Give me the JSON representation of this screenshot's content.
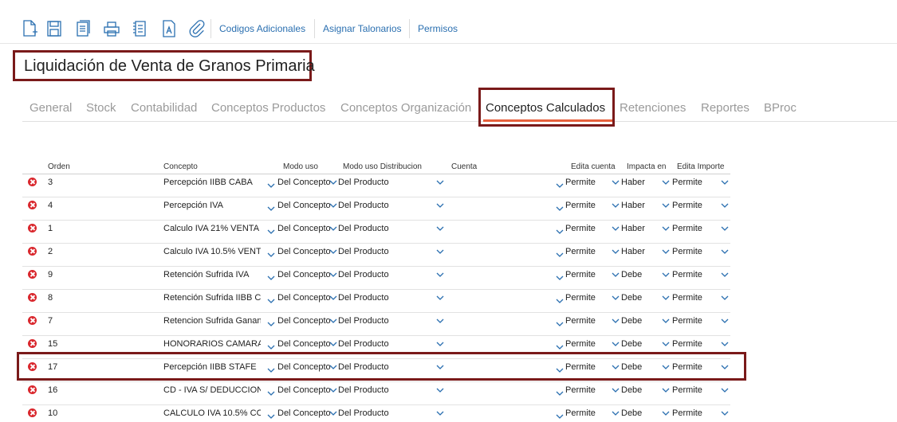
{
  "toolbar": {
    "icons": [
      "new-document-icon",
      "save-icon",
      "copy-document-icon",
      "print-icon",
      "document-list-icon",
      "text-document-icon",
      "attachment-icon"
    ],
    "links": [
      "Codigos Adicionales",
      "Asignar Talonarios",
      "Permisos"
    ]
  },
  "page": {
    "title": "Liquidación de Venta de Granos Primaria"
  },
  "tabs": [
    "General",
    "Stock",
    "Contabilidad",
    "Conceptos Productos",
    "Conceptos Organización",
    "Conceptos Calculados",
    "Retenciones",
    "Reportes",
    "BProc"
  ],
  "active_tab": "Conceptos Calculados",
  "grid": {
    "headers": [
      "Orden",
      "Concepto",
      "Modo uso",
      "Modo uso Distribucion",
      "Cuenta",
      "Edita cuenta",
      "Impacta en",
      "Edita Importe"
    ],
    "rows": [
      {
        "orden": "3",
        "concepto": "Percepción IIBB CABA",
        "modo_uso": "Del Concepto",
        "modo_dist": "Del Producto",
        "cuenta": "",
        "edita_cuenta": "Permite",
        "impacta": "Haber",
        "edita_importe": "Permite"
      },
      {
        "orden": "4",
        "concepto": "Percepción IVA",
        "modo_uso": "Del Concepto",
        "modo_dist": "Del Producto",
        "cuenta": "",
        "edita_cuenta": "Permite",
        "impacta": "Haber",
        "edita_importe": "Permite"
      },
      {
        "orden": "1",
        "concepto": "Calculo IVA 21% VENTA",
        "modo_uso": "Del Concepto",
        "modo_dist": "Del Producto",
        "cuenta": "",
        "edita_cuenta": "Permite",
        "impacta": "Haber",
        "edita_importe": "Permite"
      },
      {
        "orden": "2",
        "concepto": "Calculo IVA 10.5% VENT",
        "modo_uso": "Del Concepto",
        "modo_dist": "Del Producto",
        "cuenta": "",
        "edita_cuenta": "Permite",
        "impacta": "Haber",
        "edita_importe": "Permite"
      },
      {
        "orden": "9",
        "concepto": "Retención Sufrida IVA",
        "modo_uso": "Del Concepto",
        "modo_dist": "Del Producto",
        "cuenta": "",
        "edita_cuenta": "Permite",
        "impacta": "Debe",
        "edita_importe": "Permite"
      },
      {
        "orden": "8",
        "concepto": "Retención Sufrida IIBB C",
        "modo_uso": "Del Concepto",
        "modo_dist": "Del Producto",
        "cuenta": "",
        "edita_cuenta": "Permite",
        "impacta": "Debe",
        "edita_importe": "Permite"
      },
      {
        "orden": "7",
        "concepto": "Retencion Sufrida Ganan",
        "modo_uso": "Del Concepto",
        "modo_dist": "Del Producto",
        "cuenta": "",
        "edita_cuenta": "Permite",
        "impacta": "Debe",
        "edita_importe": "Permite"
      },
      {
        "orden": "15",
        "concepto": "HONORARIOS CAMARA",
        "modo_uso": "Del Concepto",
        "modo_dist": "Del Producto",
        "cuenta": "",
        "edita_cuenta": "Permite",
        "impacta": "Debe",
        "edita_importe": "Permite"
      },
      {
        "orden": "17",
        "concepto": "Percepción IIBB STAFE",
        "modo_uso": "Del Concepto",
        "modo_dist": "Del Producto",
        "cuenta": "",
        "edita_cuenta": "Permite",
        "impacta": "Debe",
        "edita_importe": "Permite"
      },
      {
        "orden": "16",
        "concepto": "CD - IVA S/ DEDUCCION",
        "modo_uso": "Del Concepto",
        "modo_dist": "Del Producto",
        "cuenta": "",
        "edita_cuenta": "Permite",
        "impacta": "Debe",
        "edita_importe": "Permite"
      },
      {
        "orden": "10",
        "concepto": "CALCULO IVA 10.5% CO",
        "modo_uso": "Del Concepto",
        "modo_dist": "Del Producto",
        "cuenta": "",
        "edita_cuenta": "Permite",
        "impacta": "Debe",
        "edita_importe": "Permite"
      }
    ]
  },
  "colors": {
    "accent": "#e8613d",
    "highlight": "#7a1a1a",
    "link": "#2a6fb0",
    "delete": "#d9262c"
  }
}
